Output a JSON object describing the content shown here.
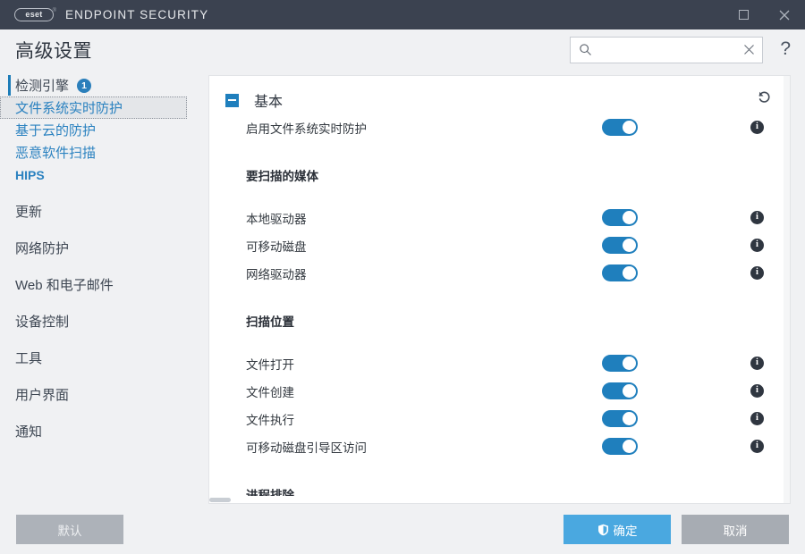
{
  "titlebar": {
    "logo_text": "eset",
    "app_title": "ENDPOINT SECURITY",
    "maximize_label": "Maximize",
    "close_label": "Close"
  },
  "header": {
    "page_title": "高级设置",
    "search": {
      "value": "",
      "placeholder": "",
      "icon": "search-icon",
      "clear_icon": "close-icon"
    },
    "help_label": "?"
  },
  "sidebar": {
    "items": [
      {
        "label": "检测引擎",
        "badge": "1",
        "level": "top",
        "accented": true,
        "selected": false
      },
      {
        "label": "文件系统实时防护",
        "badge": null,
        "level": "sub",
        "accented": false,
        "selected": true
      },
      {
        "label": "基于云的防护",
        "badge": null,
        "level": "sub",
        "accented": false,
        "selected": false
      },
      {
        "label": "恶意软件扫描",
        "badge": null,
        "level": "sub",
        "accented": false,
        "selected": false
      },
      {
        "label": "HIPS",
        "badge": null,
        "level": "sub-bold",
        "accented": false,
        "selected": false
      },
      {
        "label": "更新",
        "badge": null,
        "level": "top",
        "accented": false,
        "selected": false
      },
      {
        "label": "网络防护",
        "badge": null,
        "level": "top",
        "accented": false,
        "selected": false
      },
      {
        "label": "Web 和电子邮件",
        "badge": null,
        "level": "top",
        "accented": false,
        "selected": false
      },
      {
        "label": "设备控制",
        "badge": null,
        "level": "top",
        "accented": false,
        "selected": false
      },
      {
        "label": "工具",
        "badge": null,
        "level": "top",
        "accented": false,
        "selected": false
      },
      {
        "label": "用户界面",
        "badge": null,
        "level": "top",
        "accented": false,
        "selected": false
      },
      {
        "label": "通知",
        "badge": null,
        "level": "top",
        "accented": false,
        "selected": false
      }
    ]
  },
  "panel": {
    "section_title": "基本",
    "collapse_icon": "collapse-minus-icon",
    "revert_icon": "undo-arrow-icon",
    "rows": [
      {
        "label": "启用文件系统实时防护",
        "toggle": "on",
        "info": true
      }
    ],
    "groups": [
      {
        "title": "要扫描的媒体",
        "rows": [
          {
            "label": "本地驱动器",
            "toggle": "on",
            "info": true
          },
          {
            "label": "可移动磁盘",
            "toggle": "on",
            "info": true
          },
          {
            "label": "网络驱动器",
            "toggle": "on",
            "info": true
          }
        ]
      },
      {
        "title": "扫描位置",
        "rows": [
          {
            "label": "文件打开",
            "toggle": "on",
            "info": true
          },
          {
            "label": "文件创建",
            "toggle": "on",
            "info": true
          },
          {
            "label": "文件执行",
            "toggle": "on",
            "info": true
          },
          {
            "label": "可移动磁盘引导区访问",
            "toggle": "on",
            "info": true
          }
        ]
      },
      {
        "title": "进程排除",
        "rows": []
      }
    ]
  },
  "footer": {
    "default_label": "默认",
    "ok_label": "确定",
    "ok_icon": "shield-icon",
    "cancel_label": "取消"
  },
  "colors": {
    "titlebar_bg": "#3b4250",
    "accent_blue": "#1f7fbd",
    "link_blue": "#2b82c0",
    "ok_button": "#4aa8e0",
    "gray_button": "#a7acb3",
    "panel_bg": "#ffffff",
    "app_bg": "#f0f1f3"
  }
}
